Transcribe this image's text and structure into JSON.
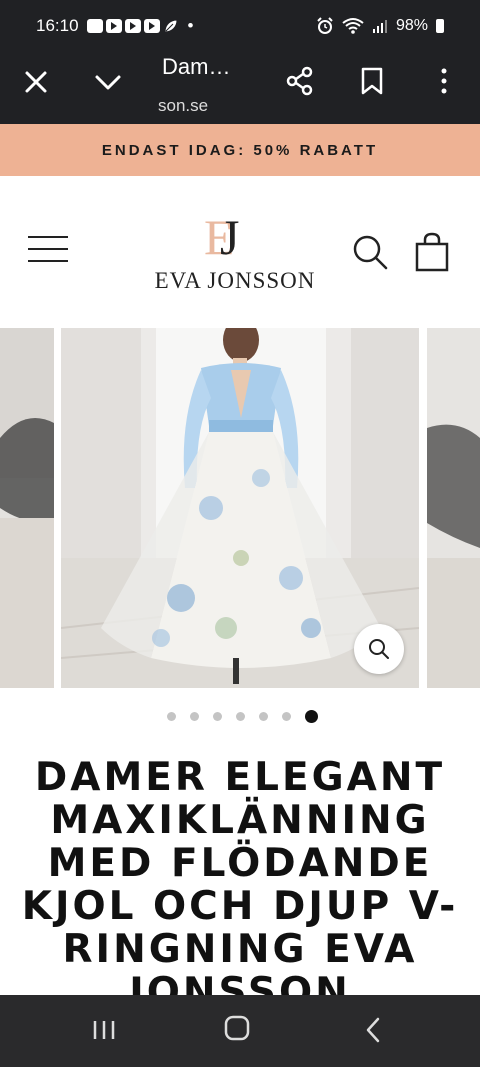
{
  "status_bar": {
    "time": "16:10",
    "battery": "98%",
    "dot": "•"
  },
  "browser": {
    "tab_title": "Dam…",
    "url": "son.se"
  },
  "promo": {
    "text": "ENDAST IDAG: 50% RABATT"
  },
  "brand": {
    "monogram": "EJ",
    "name": "EVA JONSSON"
  },
  "gallery": {
    "slide_count": 7,
    "active_index": 6
  },
  "product": {
    "title": "DAMER ELEGANT MAXIKLÄNNING MED FLÖDANDE KJOL OCH DJUP V-RINGNING EVA JONSSON"
  },
  "colors": {
    "promo_bg": "#eeb294",
    "chrome_bg": "#202124",
    "nav_bg": "#2a2a2c",
    "dress_blue": "#a9cdeb"
  }
}
